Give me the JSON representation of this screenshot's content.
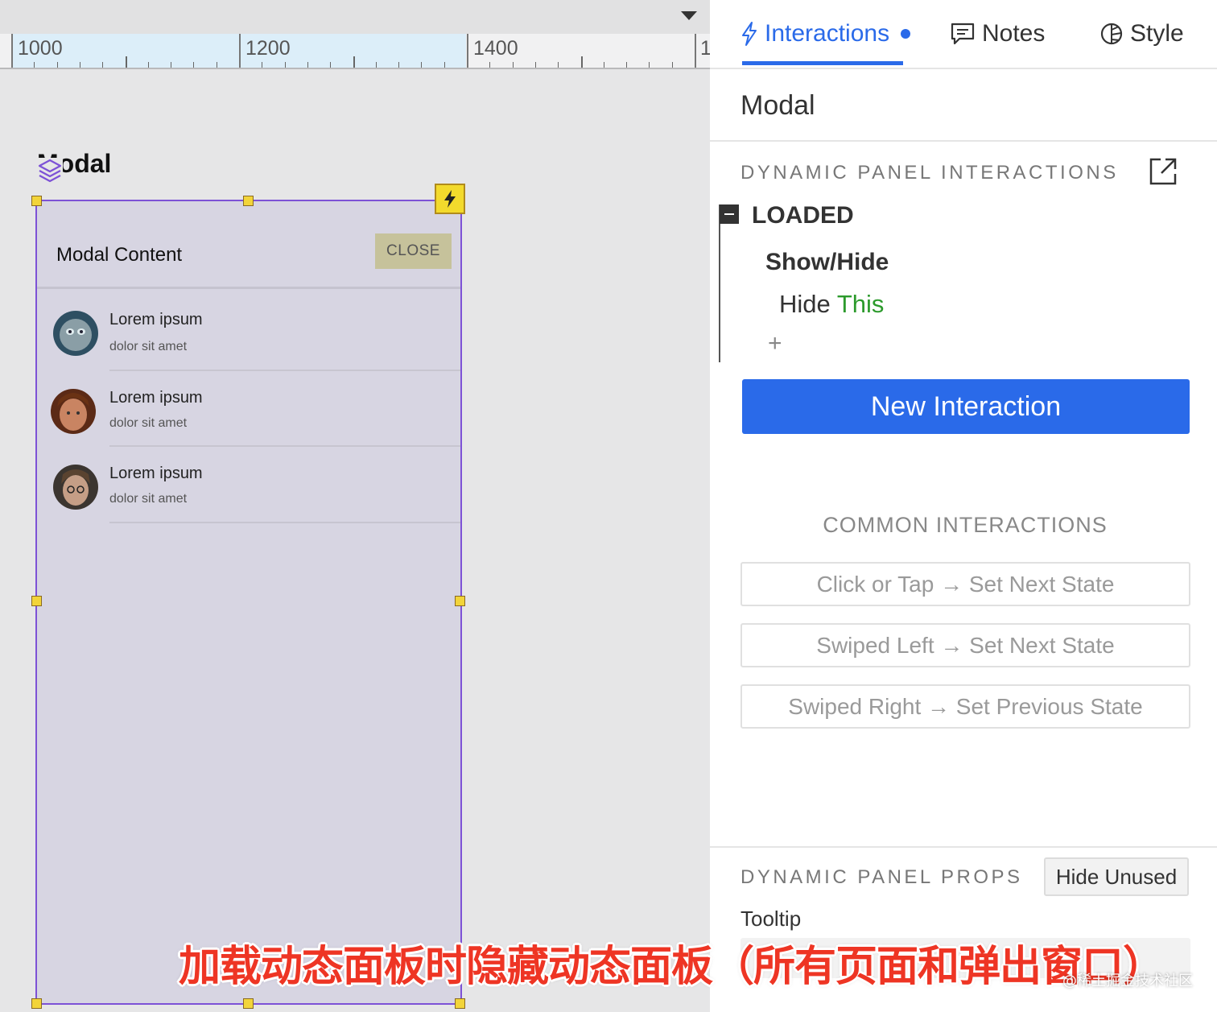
{
  "ruler": {
    "labels": [
      "1000",
      "1200",
      "1400",
      "1"
    ]
  },
  "canvas": {
    "panel_title": "Modal",
    "modal": {
      "title": "Modal Content",
      "close_label": "CLOSE",
      "items": [
        {
          "title": "Lorem ipsum",
          "subtitle": "dolor sit amet"
        },
        {
          "title": "Lorem ipsum",
          "subtitle": "dolor sit amet"
        },
        {
          "title": "Lorem ipsum",
          "subtitle": "dolor sit amet"
        }
      ]
    }
  },
  "panel": {
    "tabs": [
      {
        "label": "Interactions",
        "icon": "lightning-icon",
        "active": true
      },
      {
        "label": "Notes",
        "icon": "note-icon",
        "active": false
      },
      {
        "label": "Style",
        "icon": "style-icon",
        "active": false
      }
    ],
    "widget_name": "Modal",
    "interactions_title": "DYNAMIC PANEL INTERACTIONS",
    "event": "LOADED",
    "action": "Show/Hide",
    "action_verb": "Hide",
    "action_target": "This",
    "add_symbol": "+",
    "new_interaction_label": "New Interaction",
    "common_title": "COMMON INTERACTIONS",
    "common": [
      "Click or Tap → Set Next State",
      "Swiped Left → Set Next State",
      "Swiped Right → Set Previous State"
    ],
    "props_title": "DYNAMIC PANEL PROPS",
    "hide_unused_label": "Hide Unused",
    "tooltip_label": "Tooltip"
  },
  "overlay": {
    "caption": "加载动态面板时隐藏动态面板（所有页面和弹出窗口）",
    "watermark": "@稀土掘金技术社区"
  },
  "colors": {
    "accent": "#2a6ae9",
    "selection": "#7d52d6",
    "target_green": "#2c9a2c",
    "caption_red": "#ee3524"
  }
}
